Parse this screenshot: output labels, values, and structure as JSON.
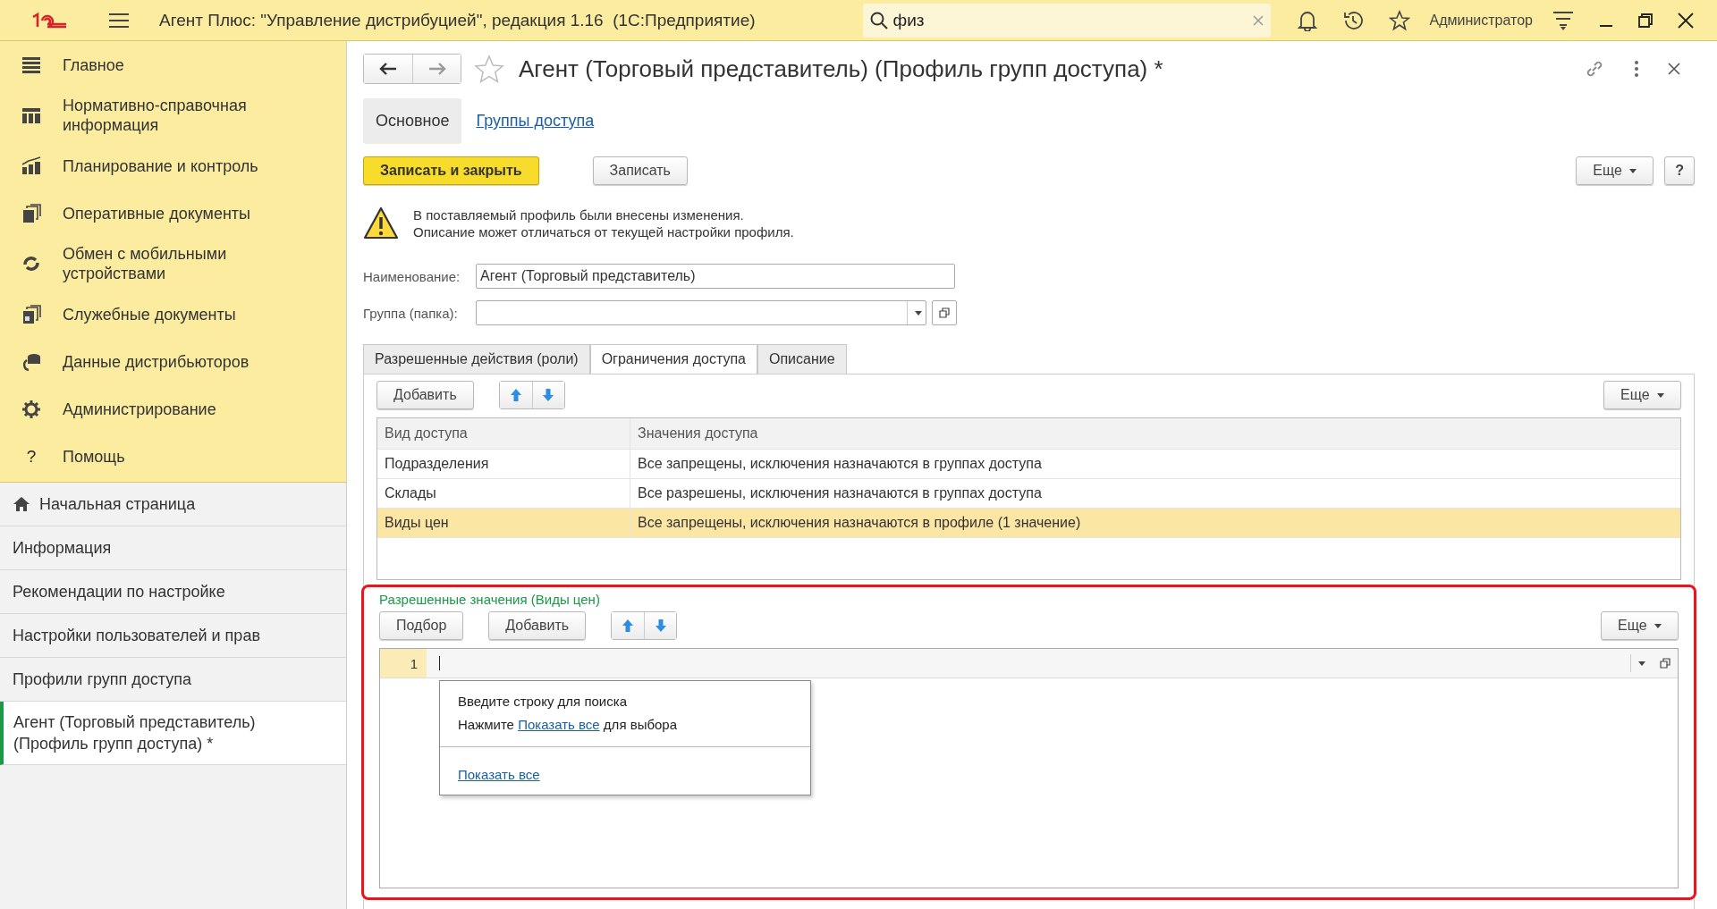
{
  "window": {
    "title": "Агент Плюс: \"Управление дистрибуцией\", редакция 1.16  (1С:Предприятие)",
    "search": {
      "value": "физ"
    },
    "user": "Администратор"
  },
  "sidebar": {
    "sections": [
      {
        "label": "Главное",
        "kind": "main"
      },
      {
        "label": "Нормативно-справочная информация",
        "kind": "catalog"
      },
      {
        "label": "Планирование и контроль",
        "kind": "chart"
      },
      {
        "label": "Оперативные документы",
        "kind": "docs"
      },
      {
        "label": "Обмен с мобильными устройствами",
        "kind": "sync"
      },
      {
        "label": "Служебные документы",
        "kind": "service"
      },
      {
        "label": "Данные дистрибьюторов",
        "kind": "data"
      },
      {
        "label": "Администрирование",
        "kind": "gear"
      },
      {
        "label": "Помощь",
        "kind": "help",
        "glyph": "?"
      }
    ],
    "open_pages": [
      {
        "label": "Начальная страница",
        "kind": "home",
        "selected": false
      },
      {
        "label": "Информация",
        "kind": "page",
        "selected": false
      },
      {
        "label": "Рекомендации по настройке",
        "kind": "page",
        "selected": false
      },
      {
        "label": "Настройки пользователей и прав",
        "kind": "page",
        "selected": false
      },
      {
        "label": "Профили групп доступа",
        "kind": "page",
        "selected": false
      },
      {
        "label": "Агент (Торговый представитель) (Профиль групп доступа) *",
        "kind": "page",
        "selected": true
      }
    ]
  },
  "form": {
    "title": "Агент (Торговый представитель) (Профиль групп доступа) *",
    "tabs": [
      {
        "label": "Основное",
        "selected": true
      },
      {
        "label": "Группы доступа",
        "selected": false
      }
    ],
    "buttons": [
      {
        "label": "Записать и закрыть",
        "kind": "primary"
      },
      {
        "label": "Записать",
        "kind": "normal"
      }
    ],
    "more": "Еще",
    "help": "?",
    "warning": [
      "В поставляемый профиль были внесены изменения.",
      "Описание может отличаться от текущей настройки профиля."
    ],
    "fields": [
      {
        "label": "Наименование:",
        "value": "Агент (Торговый представитель)",
        "kind": "text"
      },
      {
        "label": "Группа (папка):",
        "kind": "select"
      }
    ],
    "inner_tabs": [
      {
        "label": "Разрешенные действия (роли)",
        "selected": false
      },
      {
        "label": "Ограничения доступа",
        "selected": true
      },
      {
        "label": "Описание",
        "selected": false
      }
    ],
    "access_table": {
      "add": "Добавить",
      "more": "Еще",
      "columns": [
        "Вид доступа",
        "Значения доступа"
      ],
      "rows": [
        {
          "cells": [
            "Подразделения",
            "Все запрещены, исключения назначаются в группах доступа"
          ],
          "selected": false
        },
        {
          "cells": [
            "Склады",
            "Все разрешены, исключения назначаются в группах доступа"
          ],
          "selected": false
        },
        {
          "cells": [
            "Виды цен",
            "Все запрещены, исключения назначаются в профиле (1 значение)"
          ],
          "selected": true
        }
      ]
    },
    "allowed": {
      "title": "Разрешенные значения (Виды цен)",
      "highlighted": true,
      "buttons": [
        "Подбор",
        "Добавить"
      ],
      "more": "Еще",
      "rows": [
        {
          "number": "1"
        }
      ],
      "popup": {
        "hint": "Введите строку для поиска",
        "before": "Нажмите ",
        "link": "Показать все",
        "after": " для выбора",
        "footer_link": "Показать все"
      }
    }
  }
}
